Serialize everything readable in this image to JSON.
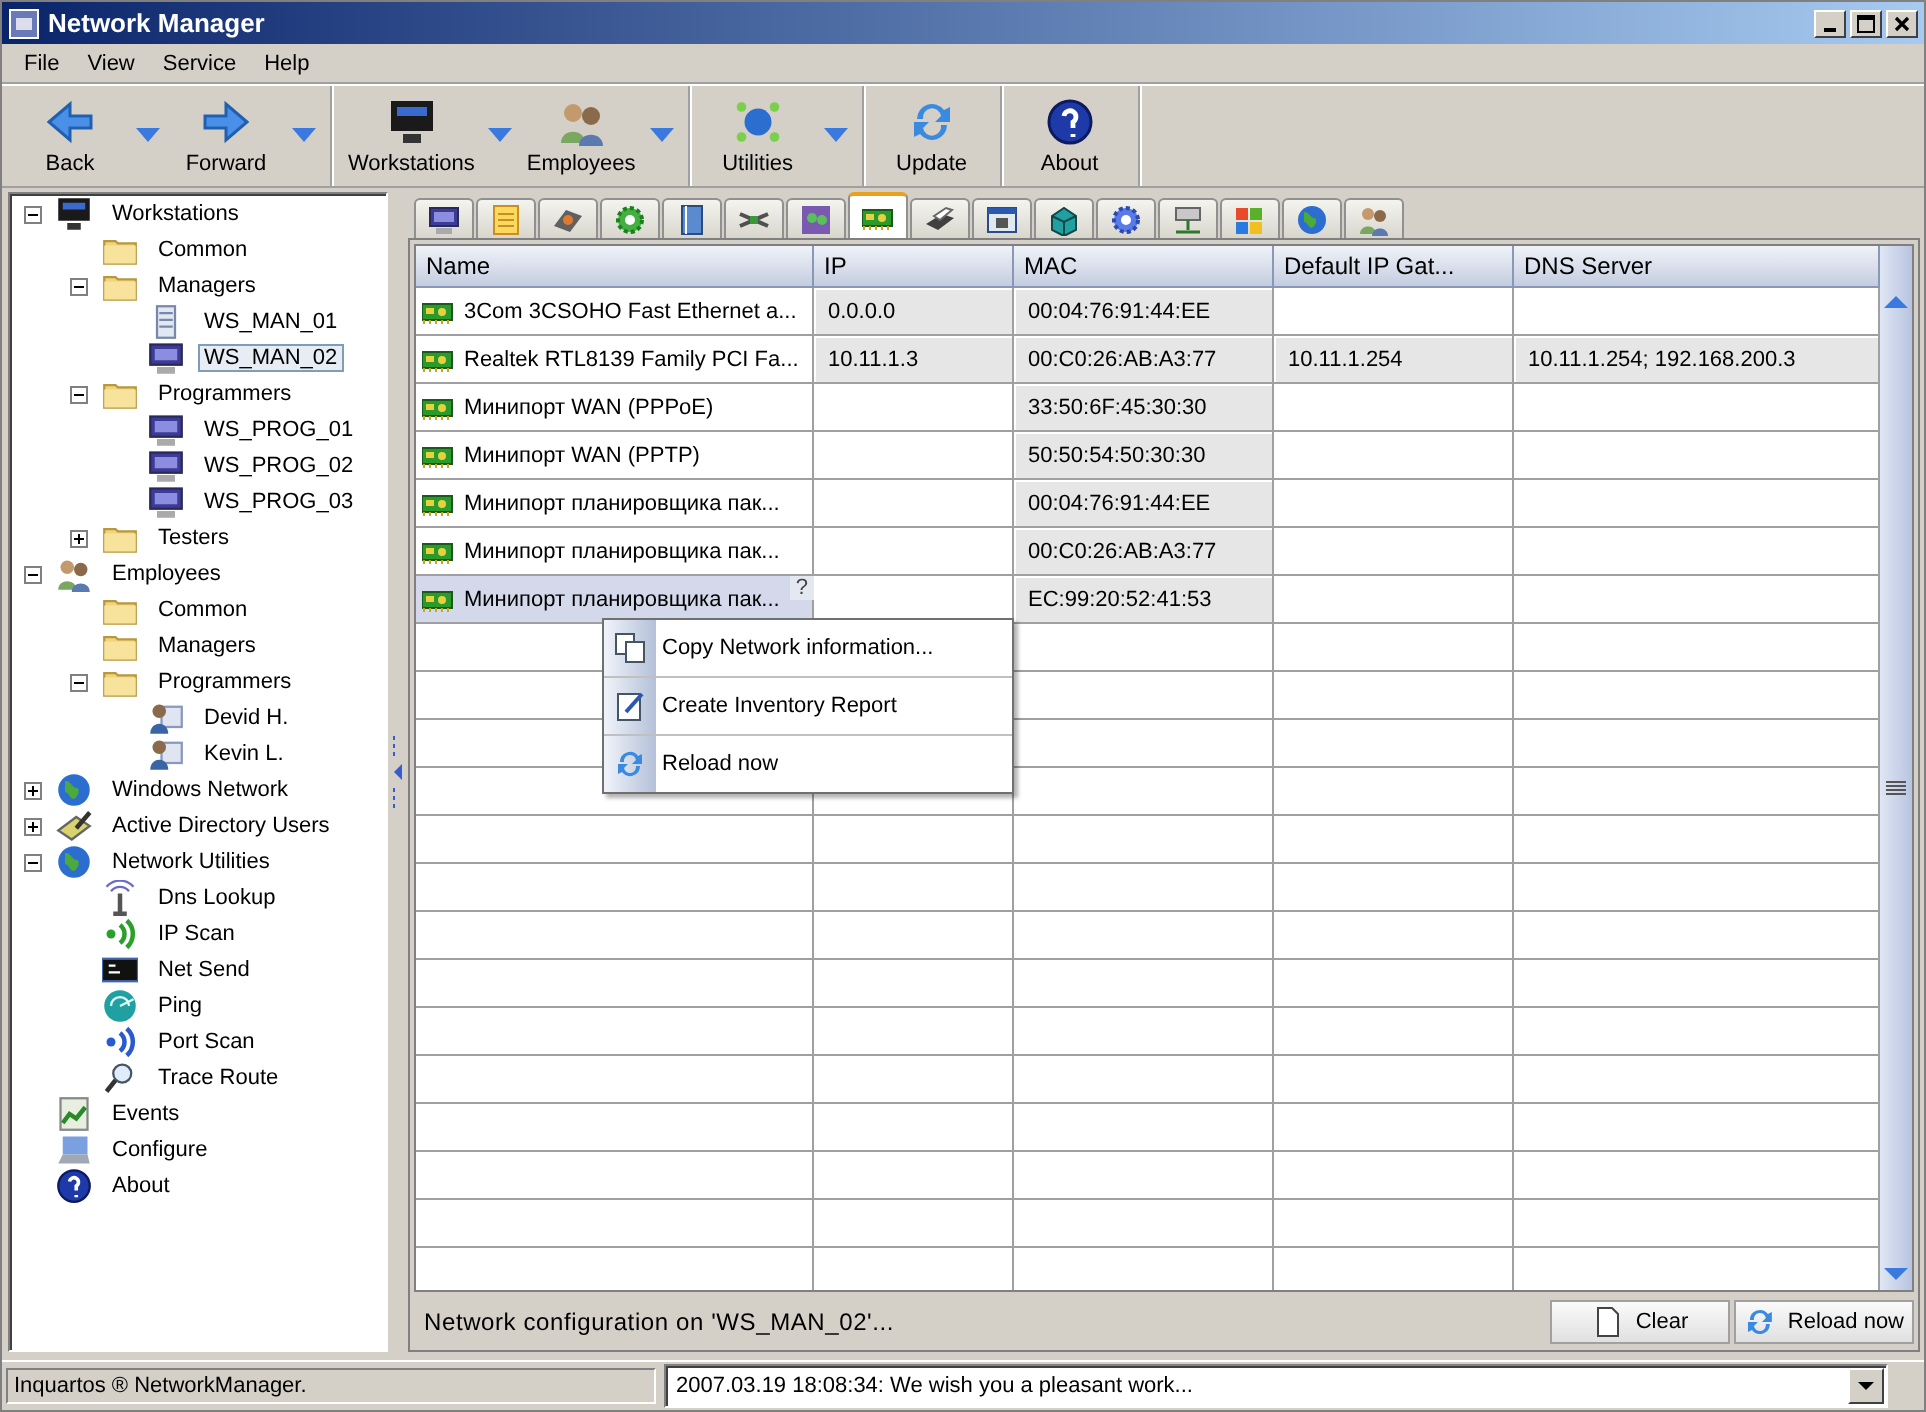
{
  "window": {
    "title": "Network Manager"
  },
  "menu": [
    "File",
    "View",
    "Service",
    "Help"
  ],
  "toolbar_groups": [
    {
      "buttons": [
        {
          "label": "Back",
          "kind": "back",
          "dropdown": true
        },
        {
          "label": "Forward",
          "kind": "forward",
          "dropdown": true
        }
      ]
    },
    {
      "buttons": [
        {
          "label": "Workstations",
          "kind": "workstations",
          "dropdown": true
        },
        {
          "label": "Employees",
          "kind": "employees",
          "dropdown": true
        }
      ]
    },
    {
      "buttons": [
        {
          "label": "Utilities",
          "kind": "utilities",
          "dropdown": true
        }
      ]
    },
    {
      "buttons": [
        {
          "label": "Update",
          "kind": "update",
          "dropdown": false
        }
      ]
    },
    {
      "buttons": [
        {
          "label": "About",
          "kind": "about",
          "dropdown": false
        }
      ]
    }
  ],
  "tree": [
    {
      "label": "Workstations",
      "kind": "darkmonitor",
      "expanded": true,
      "selected": false,
      "children": [
        {
          "label": "Common",
          "kind": "folder",
          "selected": false
        },
        {
          "label": "Managers",
          "kind": "folder",
          "expanded": true,
          "selected": false,
          "children": [
            {
              "label": "WS_MAN_01",
              "kind": "server",
              "selected": false
            },
            {
              "label": "WS_MAN_02",
              "kind": "monitor",
              "selected": true
            }
          ]
        },
        {
          "label": "Programmers",
          "kind": "folder",
          "expanded": true,
          "selected": false,
          "children": [
            {
              "label": "WS_PROG_01",
              "kind": "monitor",
              "selected": false
            },
            {
              "label": "WS_PROG_02",
              "kind": "monitor",
              "selected": false
            },
            {
              "label": "WS_PROG_03",
              "kind": "monitor",
              "selected": false
            }
          ]
        },
        {
          "label": "Testers",
          "kind": "folder",
          "expanded": false,
          "selected": false
        }
      ]
    },
    {
      "label": "Employees",
      "kind": "group",
      "expanded": true,
      "selected": false,
      "children": [
        {
          "label": "Common",
          "kind": "folder",
          "selected": false
        },
        {
          "label": "Managers",
          "kind": "folder",
          "selected": false
        },
        {
          "label": "Programmers",
          "kind": "folder",
          "expanded": true,
          "selected": false,
          "children": [
            {
              "label": "Devid H.",
              "kind": "person",
              "selected": false
            },
            {
              "label": "Kevin L.",
              "kind": "person",
              "selected": false
            }
          ]
        }
      ]
    },
    {
      "label": "Windows Network",
      "kind": "globe",
      "expanded": false,
      "selected": false
    },
    {
      "label": "Active Directory Users",
      "kind": "directory",
      "expanded": false,
      "selected": false
    },
    {
      "label": "Network Utilities",
      "kind": "globe",
      "expanded": true,
      "selected": false,
      "children": [
        {
          "label": "Dns Lookup",
          "kind": "antenna",
          "selected": false
        },
        {
          "label": "IP Scan",
          "kind": "signal",
          "selected": false
        },
        {
          "label": "Net Send",
          "kind": "terminal",
          "selected": false
        },
        {
          "label": "Ping",
          "kind": "radar",
          "selected": false
        },
        {
          "label": "Port Scan",
          "kind": "signalblue",
          "selected": false
        },
        {
          "label": "Trace Route",
          "kind": "magnifier",
          "selected": false
        }
      ]
    },
    {
      "label": "Events",
      "kind": "chart",
      "selected": false
    },
    {
      "label": "Configure",
      "kind": "laptop",
      "selected": false
    },
    {
      "label": "About",
      "kind": "help",
      "selected": false
    }
  ],
  "tabs": [
    {
      "kind": "monitor",
      "selected": false
    },
    {
      "kind": "notes",
      "selected": false
    },
    {
      "kind": "disk",
      "selected": false
    },
    {
      "kind": "gear",
      "selected": false
    },
    {
      "kind": "book",
      "selected": false
    },
    {
      "kind": "cables",
      "selected": false
    },
    {
      "kind": "photo",
      "selected": false
    },
    {
      "kind": "nic",
      "selected": true
    },
    {
      "kind": "printer",
      "selected": false
    },
    {
      "kind": "window",
      "selected": false
    },
    {
      "kind": "cube",
      "selected": false
    },
    {
      "kind": "cog",
      "selected": false
    },
    {
      "kind": "network",
      "selected": false
    },
    {
      "kind": "flag",
      "selected": false
    },
    {
      "kind": "globe",
      "selected": false
    },
    {
      "kind": "group",
      "selected": false
    }
  ],
  "table": {
    "columns": [
      "Name",
      "IP",
      "MAC",
      "Default IP Gat...",
      "DNS Server"
    ],
    "rows": [
      {
        "name": "3Com 3CSOHO Fast Ethernet a...",
        "ip": "0.0.0.0",
        "mac": "00:04:76:91:44:EE",
        "selected": false
      },
      {
        "name": "Realtek RTL8139 Family PCI Fa...",
        "ip": "10.11.1.3",
        "mac": "00:C0:26:AB:A3:77",
        "gateway": "10.11.1.254",
        "dns": "10.11.1.254; 192.168.200.3",
        "selected": false
      },
      {
        "name": "Минипорт WAN (PPPoE)",
        "mac": "33:50:6F:45:30:30",
        "selected": false
      },
      {
        "name": "Минипорт WAN (PPTP)",
        "mac": "50:50:54:50:30:30",
        "selected": false
      },
      {
        "name": "Минипорт планировщика пак...",
        "mac": "00:04:76:91:44:EE",
        "selected": false
      },
      {
        "name": "Минипорт планировщика пак...",
        "mac": "00:C0:26:AB:A3:77",
        "selected": false
      },
      {
        "name": "Минипорт планировщика пак...",
        "hint": "?",
        "mac": "EC:99:20:52:41:53",
        "selected": true
      }
    ]
  },
  "context_menu": [
    {
      "label": "Copy Network information...",
      "kind": "copy"
    },
    {
      "label": "Create Inventory Report",
      "kind": "report"
    },
    {
      "label": "Reload now",
      "kind": "reload"
    }
  ],
  "panel_status": "Network configuration on 'WS_MAN_02'...",
  "panel_buttons": [
    {
      "label": "Clear",
      "kind": "clear"
    },
    {
      "label": "Reload now",
      "kind": "reload"
    }
  ],
  "status_bar": {
    "app": "Inquartos ® NetworkManager.",
    "log": "2007.03.19 18:08:34: We wish you a pleasant work..."
  }
}
